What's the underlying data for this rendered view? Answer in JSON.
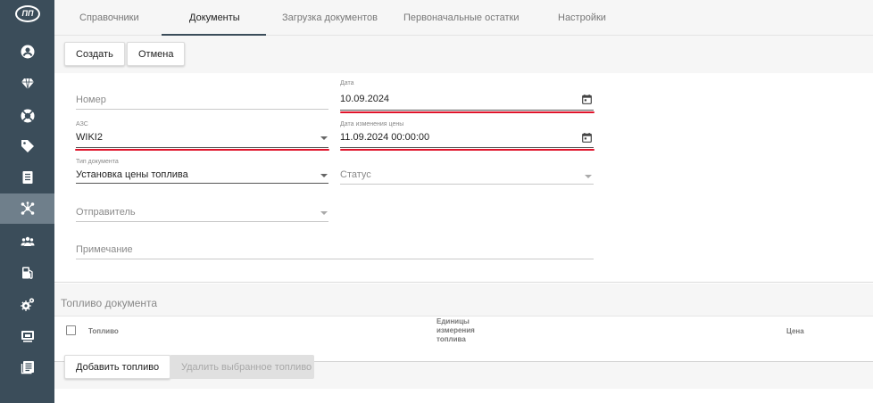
{
  "app": {
    "logo_text": "ПП"
  },
  "sidebar": {
    "items": [
      {
        "icon": "user-circle-icon",
        "active": false
      },
      {
        "icon": "diamond-icon",
        "active": false
      },
      {
        "icon": "lifebuoy-icon",
        "active": false
      },
      {
        "icon": "tag-icon",
        "active": false
      },
      {
        "icon": "document-list-icon",
        "active": false
      },
      {
        "icon": "network-nodes-icon",
        "active": true
      },
      {
        "icon": "users-group-icon",
        "active": false
      },
      {
        "icon": "fuel-pump-icon",
        "active": false
      },
      {
        "icon": "gears-icon",
        "active": false
      },
      {
        "icon": "monitor-icon",
        "active": false
      },
      {
        "icon": "news-icon",
        "active": false
      }
    ]
  },
  "tabs": [
    {
      "label": "Справочники",
      "active": false
    },
    {
      "label": "Документы",
      "active": true
    },
    {
      "label": "Загрузка документов",
      "active": false
    },
    {
      "label": "Первоначальные остатки",
      "active": false
    },
    {
      "label": "Настройки",
      "active": false
    }
  ],
  "toolbar": {
    "create_label": "Создать",
    "cancel_label": "Отмена"
  },
  "form": {
    "number": {
      "placeholder": "Номер"
    },
    "date": {
      "label": "Дата",
      "value": "10.09.2024"
    },
    "station": {
      "label": "АЗС",
      "value": "WIKI2"
    },
    "price_change_date": {
      "label": "Дата изменения цены",
      "value": "11.09.2024 00:00:00"
    },
    "doc_type": {
      "label": "Тип документа",
      "value": "Установка цены топлива"
    },
    "status": {
      "placeholder": "Статус"
    },
    "sender": {
      "placeholder": "Отправитель"
    },
    "note": {
      "placeholder": "Примечание"
    }
  },
  "fuel_section": {
    "title": "Топливо документа",
    "columns": {
      "fuel": "Топливо",
      "units_line1": "Единицы",
      "units_line2": "измерения",
      "units_line3": "топлива",
      "price": "Цена"
    },
    "add_label": "Добавить топливо",
    "delete_label": "Удалить выбранное топливо"
  },
  "colors": {
    "sidebar_bg": "#3b4d5a",
    "sidebar_active": "#6f7f8b",
    "highlight_red": "#e0142b"
  }
}
